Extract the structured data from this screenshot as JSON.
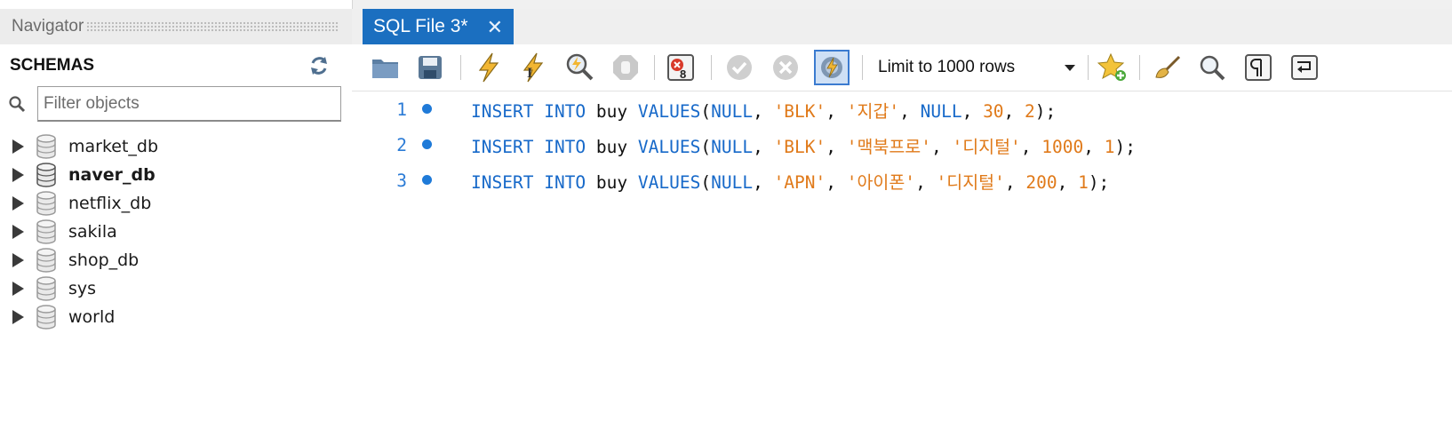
{
  "navigator": {
    "title": "Navigator",
    "schemas_label": "SCHEMAS",
    "filter_placeholder": "Filter objects",
    "schemas": [
      {
        "name": "market_db",
        "bold": false
      },
      {
        "name": "naver_db",
        "bold": true
      },
      {
        "name": "netflix_db",
        "bold": false
      },
      {
        "name": "sakila",
        "bold": false
      },
      {
        "name": "shop_db",
        "bold": false
      },
      {
        "name": "sys",
        "bold": false
      },
      {
        "name": "world",
        "bold": false
      }
    ]
  },
  "tab": {
    "label": "SQL File 3*",
    "close": "✕"
  },
  "toolbar": {
    "limit_label": "Limit to 1000 rows",
    "icons": [
      "open-folder-icon",
      "save-icon",
      "execute-icon",
      "execute-current-icon",
      "explain-icon",
      "stop-icon",
      "toggle-error-icon",
      "commit-icon",
      "rollback-icon",
      "autocommit-icon",
      "bookmark-add-icon",
      "beautify-icon",
      "find-icon",
      "invisible-chars-icon",
      "word-wrap-icon"
    ]
  },
  "editor": {
    "lines": [
      {
        "num": "1",
        "tokens": [
          {
            "t": "INSERT",
            "c": "kw"
          },
          {
            "t": " ",
            "c": "pn"
          },
          {
            "t": "INTO",
            "c": "kw"
          },
          {
            "t": " ",
            "c": "pn"
          },
          {
            "t": "buy",
            "c": "id"
          },
          {
            "t": " ",
            "c": "pn"
          },
          {
            "t": "VALUES",
            "c": "kw"
          },
          {
            "t": "(",
            "c": "pn"
          },
          {
            "t": "NULL",
            "c": "kw"
          },
          {
            "t": ", ",
            "c": "pn"
          },
          {
            "t": "'BLK'",
            "c": "str"
          },
          {
            "t": ", ",
            "c": "pn"
          },
          {
            "t": "'지갑'",
            "c": "str"
          },
          {
            "t": ", ",
            "c": "pn"
          },
          {
            "t": "NULL",
            "c": "kw"
          },
          {
            "t": ", ",
            "c": "pn"
          },
          {
            "t": "30",
            "c": "num"
          },
          {
            "t": ", ",
            "c": "pn"
          },
          {
            "t": "2",
            "c": "num"
          },
          {
            "t": ");",
            "c": "pn"
          }
        ]
      },
      {
        "num": "2",
        "tokens": [
          {
            "t": "INSERT",
            "c": "kw"
          },
          {
            "t": " ",
            "c": "pn"
          },
          {
            "t": "INTO",
            "c": "kw"
          },
          {
            "t": " ",
            "c": "pn"
          },
          {
            "t": "buy",
            "c": "id"
          },
          {
            "t": " ",
            "c": "pn"
          },
          {
            "t": "VALUES",
            "c": "kw"
          },
          {
            "t": "(",
            "c": "pn"
          },
          {
            "t": "NULL",
            "c": "kw"
          },
          {
            "t": ", ",
            "c": "pn"
          },
          {
            "t": "'BLK'",
            "c": "str"
          },
          {
            "t": ", ",
            "c": "pn"
          },
          {
            "t": "'맥북프로'",
            "c": "str"
          },
          {
            "t": ", ",
            "c": "pn"
          },
          {
            "t": "'디지털'",
            "c": "str"
          },
          {
            "t": ", ",
            "c": "pn"
          },
          {
            "t": "1000",
            "c": "num"
          },
          {
            "t": ", ",
            "c": "pn"
          },
          {
            "t": "1",
            "c": "num"
          },
          {
            "t": ");",
            "c": "pn"
          }
        ]
      },
      {
        "num": "3",
        "tokens": [
          {
            "t": "INSERT",
            "c": "kw"
          },
          {
            "t": " ",
            "c": "pn"
          },
          {
            "t": "INTO",
            "c": "kw"
          },
          {
            "t": " ",
            "c": "pn"
          },
          {
            "t": "buy",
            "c": "id"
          },
          {
            "t": " ",
            "c": "pn"
          },
          {
            "t": "VALUES",
            "c": "kw"
          },
          {
            "t": "(",
            "c": "pn"
          },
          {
            "t": "NULL",
            "c": "kw"
          },
          {
            "t": ", ",
            "c": "pn"
          },
          {
            "t": "'APN'",
            "c": "str"
          },
          {
            "t": ", ",
            "c": "pn"
          },
          {
            "t": "'아이폰'",
            "c": "str"
          },
          {
            "t": ", ",
            "c": "pn"
          },
          {
            "t": "'디지털'",
            "c": "str"
          },
          {
            "t": ", ",
            "c": "pn"
          },
          {
            "t": "200",
            "c": "num"
          },
          {
            "t": ", ",
            "c": "pn"
          },
          {
            "t": "1",
            "c": "num"
          },
          {
            "t": ");",
            "c": "pn"
          }
        ]
      }
    ]
  },
  "colors": {
    "tab_active": "#1b6fc0",
    "keyword": "#1769c9",
    "string": "#e07a1a",
    "line_number": "#2b7bd6"
  }
}
